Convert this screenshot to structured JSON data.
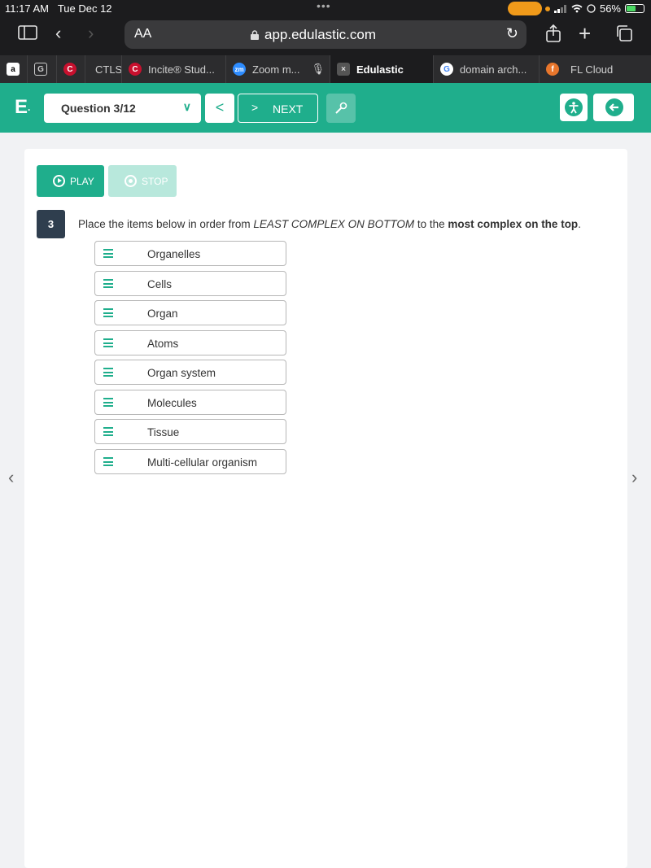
{
  "status_bar": {
    "time": "11:17 AM",
    "date": "Tue Dec 12",
    "battery": "56%"
  },
  "browser": {
    "aa_label": "AA",
    "url": "app.edulastic.com"
  },
  "tabs": [
    {
      "label": "",
      "icon": "amazon-icon"
    },
    {
      "label": "",
      "icon": "g-icon"
    },
    {
      "label": "",
      "icon": "c-icon"
    },
    {
      "label": "CTLS",
      "icon": ""
    },
    {
      "label": "Incite® Stud...",
      "icon": "c-icon"
    },
    {
      "label": "Zoom m...",
      "icon": "zoom-icon"
    },
    {
      "label": "Edulastic",
      "icon": "close-icon",
      "active": true
    },
    {
      "label": "domain arch...",
      "icon": "google-icon"
    },
    {
      "label": "FL Cloud",
      "icon": "fl-icon"
    }
  ],
  "header": {
    "logo": "E",
    "question_select": "Question 3/12",
    "next_label": "NEXT",
    "brand_color": "#1fae8c"
  },
  "player": {
    "play_label": "PLAY",
    "stop_label": "STOP"
  },
  "question": {
    "number": "3",
    "stem_start": "Place the items below in order from ",
    "stem_em": "LEAST COMPLEX ON BOTTOM",
    "stem_mid": " to the ",
    "stem_strong": "most complex on the top",
    "stem_end": ".",
    "items": [
      "Organelles",
      "Cells",
      "Organ",
      "Atoms",
      "Organ system",
      "Molecules",
      "Tissue",
      "Multi-cellular organism"
    ]
  }
}
